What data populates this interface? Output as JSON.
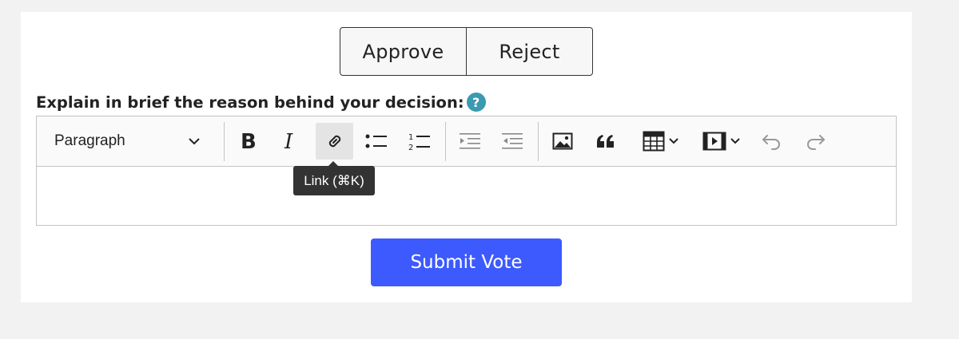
{
  "vote": {
    "approve_label": "Approve",
    "reject_label": "Reject"
  },
  "prompt": {
    "label": "Explain in brief the reason behind your decision:",
    "help_glyph": "?"
  },
  "colors": {
    "accent": "#3d5afe",
    "help": "#3b9ab0",
    "tooltip": "#333333"
  },
  "editor": {
    "block_format": "Paragraph",
    "toolbar_icons": [
      "bold-icon",
      "italic-icon",
      "link-icon",
      "bulleted-list-icon",
      "numbered-list-icon",
      "decrease-indent-icon",
      "increase-indent-icon",
      "image-icon",
      "blockquote-icon",
      "table-icon",
      "media-icon",
      "undo-icon",
      "redo-icon"
    ],
    "tooltip": "Link (⌘K)",
    "content": ""
  },
  "submit": {
    "label": "Submit Vote"
  }
}
